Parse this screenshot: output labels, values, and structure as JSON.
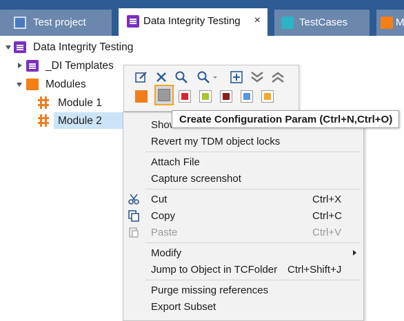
{
  "tabs": [
    {
      "label": "Test project",
      "icon": "project-icon"
    },
    {
      "label": "Data Integrity Testing",
      "icon": "purple-list-icon",
      "close": "×"
    },
    {
      "label": "TestCases",
      "icon": "teal-folder-icon"
    },
    {
      "label": "M",
      "icon": "orange-folder-icon"
    }
  ],
  "tree": {
    "root": "Data Integrity Testing",
    "templates": "_DI Templates",
    "modules": "Modules",
    "module1": "Module 1",
    "module2": "Module 2"
  },
  "tooltip": "Create Configuration Param (Ctrl+N,Ctrl+O)",
  "menu": {
    "show": "Show",
    "revert": "Revert my TDM object locks",
    "attach": "Attach File",
    "capture": "Capture screenshot",
    "cut": "Cut",
    "cut_sc": "Ctrl+X",
    "copy": "Copy",
    "copy_sc": "Ctrl+C",
    "paste": "Paste",
    "paste_sc": "Ctrl+V",
    "modify": "Modify",
    "jump": "Jump to Object in TCFolder",
    "jump_sc": "Ctrl+Shift+J",
    "purge": "Purge missing references",
    "export": "Export Subset"
  },
  "colors": {
    "tabbar": "#2d5b93",
    "selection": "#cce4f7",
    "accent_orange": "#f07d1e",
    "accent_purple": "#7a2fbf"
  }
}
